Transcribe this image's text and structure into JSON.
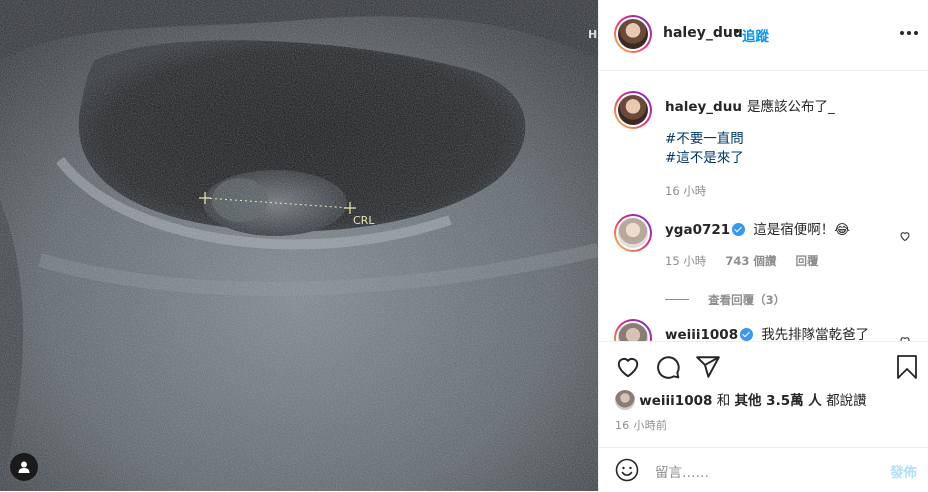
{
  "media": {
    "overlay_label": "CRL",
    "corner_letter": "H"
  },
  "post": {
    "author": "haley_duu",
    "follow_label": "追蹤",
    "separator": "•",
    "caption": "是應該公布了_",
    "hashtags": [
      "#不要一直問",
      "#這不是來了"
    ],
    "caption_time": "16 小時"
  },
  "comments": [
    {
      "user": "yga0721",
      "verified": true,
      "text": "這是宿便啊！😂",
      "time": "15 小時",
      "likes": "743 個讚",
      "reply_label": "回覆",
      "view_replies": "查看回覆（3）"
    },
    {
      "user": "weiii1008",
      "verified": true,
      "text": "我先排隊當乾爸了🙌"
    }
  ],
  "likes": {
    "user": "weiii1008",
    "connector": "和",
    "others": "其他 3.5萬 人",
    "suffix": "都說讚"
  },
  "post_time": "16 小時前",
  "comment_box": {
    "placeholder": "留言……",
    "post_label": "發佈"
  },
  "icons": {
    "like": "heart-icon",
    "comment": "comment-icon",
    "share": "paper-plane-icon",
    "save": "bookmark-icon",
    "emoji": "smiley-icon",
    "more": "more-options-icon",
    "user_tag": "user-tag-icon"
  },
  "colors": {
    "link_blue": "#0095f6",
    "hashtag": "#00376b",
    "muted": "#8e8e8e",
    "post_disabled": "#b2dffc"
  }
}
